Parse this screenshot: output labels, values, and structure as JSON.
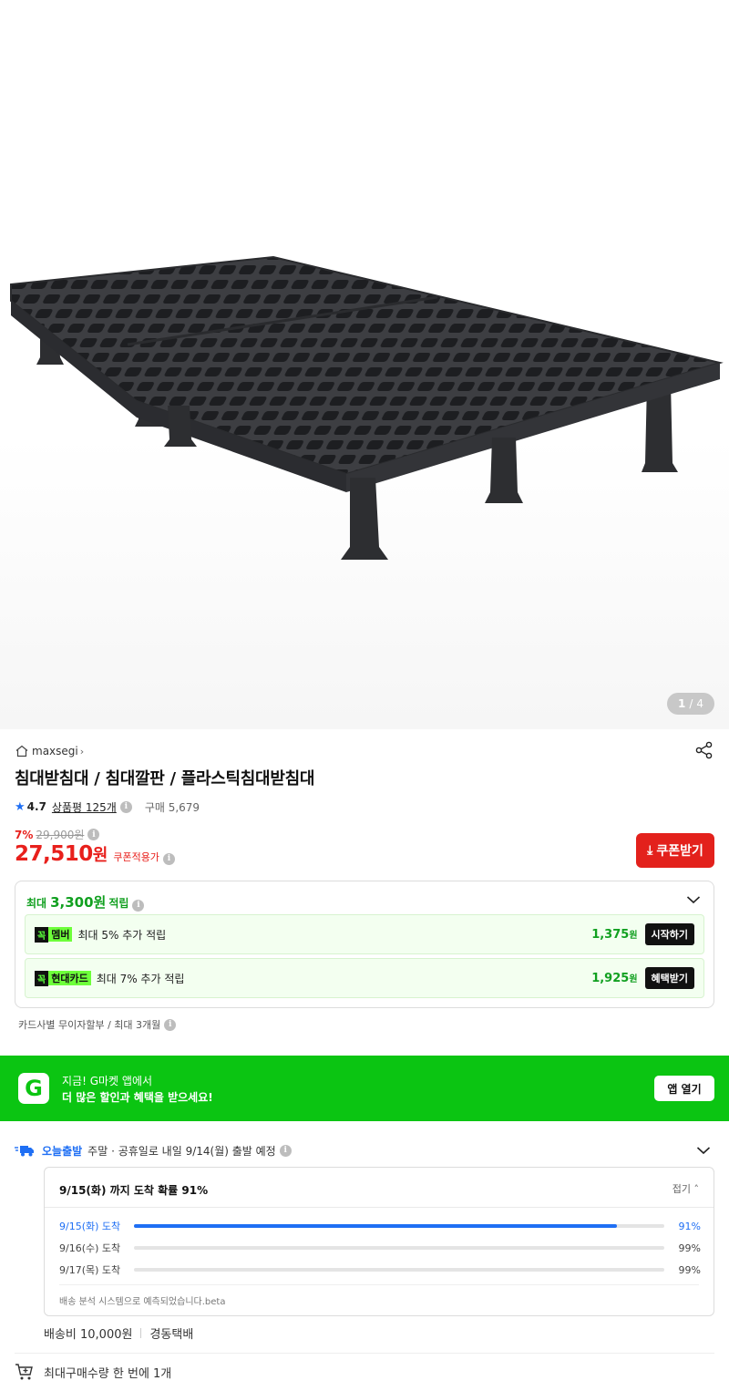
{
  "gallery": {
    "current": "1",
    "separator": "/",
    "total": "4"
  },
  "store": {
    "name": "maxsegi"
  },
  "product": {
    "title": "침대받침대 / 침대깔판 / 플라스틱침대받침대"
  },
  "rating": {
    "score": "4.7",
    "reviews_label": "상품평 125개",
    "purchases": "구매 5,679"
  },
  "price": {
    "discount": "7%",
    "original": "29,900원",
    "final": "27,510",
    "final_unit": "원",
    "coupon_note": "쿠폰적용가",
    "coupon_button": "쿠폰받기"
  },
  "points": {
    "prefix": "최대",
    "amount": "3,300원",
    "suffix": "적립",
    "rows": [
      {
        "badge_k": "꼭",
        "badge": "멤버",
        "desc": "최대 5% 추가 적립",
        "value": "1,375",
        "unit": "원",
        "action": "시작하기"
      },
      {
        "badge_k": "꼭",
        "badge": "현대카드",
        "desc": "최대 7% 추가 적립",
        "value": "1,925",
        "unit": "원",
        "action": "혜택받기"
      }
    ]
  },
  "installment": "카드사별 무이자할부 / 최대 3개월",
  "app_banner": {
    "logo": "G",
    "line1": "지금! G마켓 앱에서",
    "line2": "더 많은 할인과 혜택을 받으세요!",
    "button": "앱 열기"
  },
  "delivery": {
    "tag": "오늘출발",
    "text": "주말 · 공휴일로 내일 9/14(월) 출발 예정",
    "probability_title": "9/15(화) 까지 도착 확률 91%",
    "fold_label": "접기",
    "rows": [
      {
        "label": "9/15(화) 도착",
        "percent": "91%",
        "value": 0.91
      },
      {
        "label": "9/16(수) 도착",
        "percent": "99%",
        "value": 0
      },
      {
        "label": "9/17(목) 도착",
        "percent": "99%",
        "value": 0
      }
    ],
    "note": "배송 분석 시스템으로 예측되었습니다.beta",
    "fee": "배송비 10,000원",
    "carrier": "경동택배"
  },
  "max_purchase": "최대구매수량 한 번에 1개",
  "colors": {
    "accent_red": "#e3211c",
    "gmarket_green": "#0bc512",
    "blue": "#1f6ff4",
    "point_green": "#11a020"
  }
}
